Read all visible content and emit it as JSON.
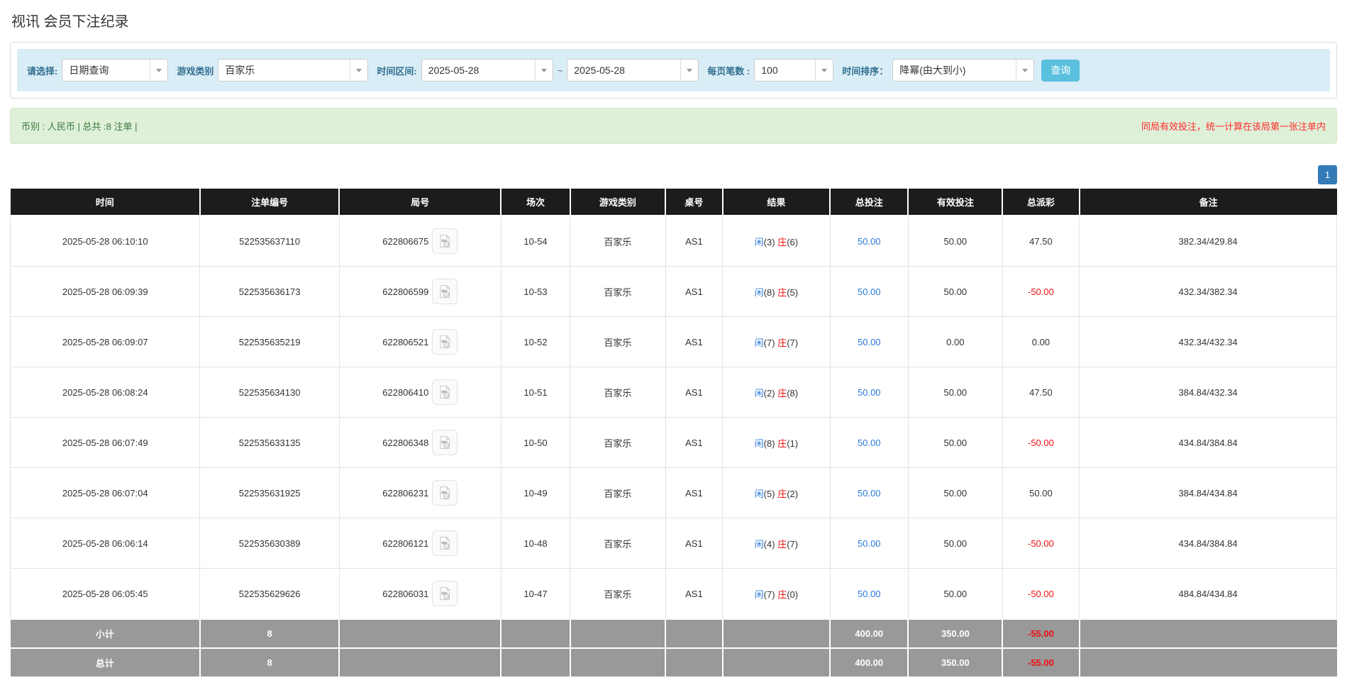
{
  "page": {
    "title": "视讯 会员下注纪录"
  },
  "colors": {
    "accent_blue": "#2a79d8",
    "accent_red": "#ee1111",
    "header_bg": "#1c1c1c",
    "total_bg": "#999999",
    "filter_bg": "#d9edf7",
    "summary_bg": "#dff0d8",
    "button_blue": "#5bc0de",
    "page_btn_blue": "#337ab7"
  },
  "filters": {
    "select_label": "请选择:",
    "select_value": "日期查询",
    "game_type_label": "游戏类别",
    "game_type_value": "百家乐",
    "time_range_label": "时间区间:",
    "date_from": "2025-05-28",
    "tilde": "~",
    "date_to": "2025-05-28",
    "per_page_label": "每页笔数 :",
    "per_page_value": "100",
    "sort_label": "时间排序：",
    "sort_value": "降幂(由大到小)",
    "search_button": "查询"
  },
  "summary": {
    "left": "币别 : 人民币 | 总共 :8 注单 |",
    "right": "同局有效投注，统一计算在该局第一张注单内"
  },
  "pagination": {
    "current_page": "1"
  },
  "table": {
    "headers": [
      "时间",
      "注单编号",
      "局号",
      "场次",
      "游戏类别",
      "桌号",
      "结果",
      "总投注",
      "有效投注",
      "总派彩",
      "备注"
    ],
    "rows": [
      {
        "time": "2025-05-28 06:10:10",
        "bet_id": "522535637110",
        "round_id": "622806675",
        "session": "10-54",
        "game": "百家乐",
        "table_no": "AS1",
        "result_player_label": "闲",
        "result_player_value": "(3)",
        "result_banker_label": "庄",
        "result_banker_value": "(6)",
        "total_bet": "50.00",
        "valid_bet": "50.00",
        "payout": "47.50",
        "note": "382.34/429.84"
      },
      {
        "time": "2025-05-28 06:09:39",
        "bet_id": "522535636173",
        "round_id": "622806599",
        "session": "10-53",
        "game": "百家乐",
        "table_no": "AS1",
        "result_player_label": "闲",
        "result_player_value": "(8)",
        "result_banker_label": "庄",
        "result_banker_value": "(5)",
        "total_bet": "50.00",
        "valid_bet": "50.00",
        "payout": "-50.00",
        "note": "432.34/382.34"
      },
      {
        "time": "2025-05-28 06:09:07",
        "bet_id": "522535635219",
        "round_id": "622806521",
        "session": "10-52",
        "game": "百家乐",
        "table_no": "AS1",
        "result_player_label": "闲",
        "result_player_value": "(7)",
        "result_banker_label": "庄",
        "result_banker_value": "(7)",
        "total_bet": "50.00",
        "valid_bet": "0.00",
        "payout": "0.00",
        "note": "432.34/432.34"
      },
      {
        "time": "2025-05-28 06:08:24",
        "bet_id": "522535634130",
        "round_id": "622806410",
        "session": "10-51",
        "game": "百家乐",
        "table_no": "AS1",
        "result_player_label": "闲",
        "result_player_value": "(2)",
        "result_banker_label": "庄",
        "result_banker_value": "(8)",
        "total_bet": "50.00",
        "valid_bet": "50.00",
        "payout": "47.50",
        "note": "384.84/432.34"
      },
      {
        "time": "2025-05-28 06:07:49",
        "bet_id": "522535633135",
        "round_id": "622806348",
        "session": "10-50",
        "game": "百家乐",
        "table_no": "AS1",
        "result_player_label": "闲",
        "result_player_value": "(8)",
        "result_banker_label": "庄",
        "result_banker_value": "(1)",
        "total_bet": "50.00",
        "valid_bet": "50.00",
        "payout": "-50.00",
        "note": "434.84/384.84"
      },
      {
        "time": "2025-05-28 06:07:04",
        "bet_id": "522535631925",
        "round_id": "622806231",
        "session": "10-49",
        "game": "百家乐",
        "table_no": "AS1",
        "result_player_label": "闲",
        "result_player_value": "(5)",
        "result_banker_label": "庄",
        "result_banker_value": "(2)",
        "total_bet": "50.00",
        "valid_bet": "50.00",
        "payout": "50.00",
        "note": "384.84/434.84"
      },
      {
        "time": "2025-05-28 06:06:14",
        "bet_id": "522535630389",
        "round_id": "622806121",
        "session": "10-48",
        "game": "百家乐",
        "table_no": "AS1",
        "result_player_label": "闲",
        "result_player_value": "(4)",
        "result_banker_label": "庄",
        "result_banker_value": "(7)",
        "total_bet": "50.00",
        "valid_bet": "50.00",
        "payout": "-50.00",
        "note": "434.84/384.84"
      },
      {
        "time": "2025-05-28 06:05:45",
        "bet_id": "522535629626",
        "round_id": "622806031",
        "session": "10-47",
        "game": "百家乐",
        "table_no": "AS1",
        "result_player_label": "闲",
        "result_player_value": "(7)",
        "result_banker_label": "庄",
        "result_banker_value": "(0)",
        "total_bet": "50.00",
        "valid_bet": "50.00",
        "payout": "-50.00",
        "note": "484.84/434.84"
      }
    ],
    "subtotal": {
      "label": "小计",
      "count": "8",
      "total_bet": "400.00",
      "valid_bet": "350.00",
      "payout": "-55.00"
    },
    "grand_total": {
      "label": "总计",
      "count": "8",
      "total_bet": "400.00",
      "valid_bet": "350.00",
      "payout": "-55.00"
    }
  }
}
